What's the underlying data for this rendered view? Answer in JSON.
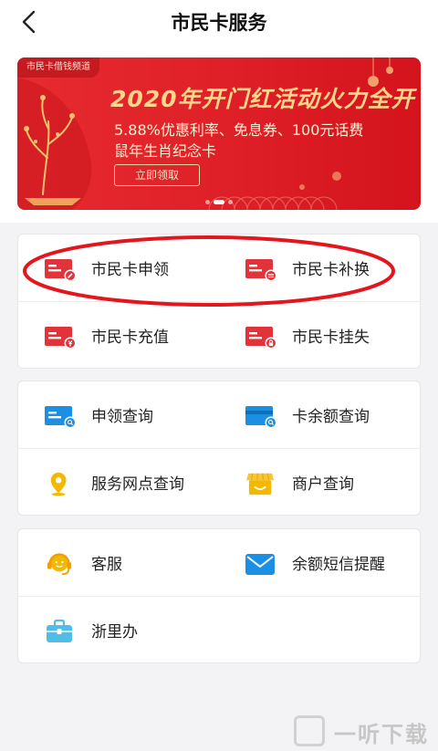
{
  "nav": {
    "title": "市民卡服务"
  },
  "banner": {
    "channel": "市民卡借钱频道",
    "headline": "2020年开门红活动火力全开",
    "line1": "5.88%优惠利率、免息券、100元话费",
    "line2": "鼠年生肖纪念卡",
    "cta": "立即领取",
    "page_count": 3,
    "active_page": 1
  },
  "card_services": {
    "items": [
      {
        "label": "市民卡申领",
        "icon": "card-apply-icon"
      },
      {
        "label": "市民卡补换",
        "icon": "card-replace-icon"
      },
      {
        "label": "市民卡充值",
        "icon": "card-recharge-icon"
      },
      {
        "label": "市民卡挂失",
        "icon": "card-lock-icon"
      }
    ]
  },
  "queries": {
    "items": [
      {
        "label": "申领查询",
        "icon": "apply-query-icon"
      },
      {
        "label": "卡余额查询",
        "icon": "balance-query-icon"
      },
      {
        "label": "服务网点查询",
        "icon": "location-pin-icon"
      },
      {
        "label": "商户查询",
        "icon": "shop-icon"
      }
    ]
  },
  "support": {
    "items": [
      {
        "label": "客服",
        "icon": "headset-icon"
      },
      {
        "label": "余额短信提醒",
        "icon": "mail-icon"
      },
      {
        "label": "浙里办",
        "icon": "briefcase-icon"
      }
    ]
  },
  "colors": {
    "accent_red": "#e0333a",
    "accent_blue": "#1a8fe3",
    "accent_yellow": "#f5b800",
    "highlight": "#e3161e"
  },
  "watermark": {
    "text": "一听下载"
  }
}
